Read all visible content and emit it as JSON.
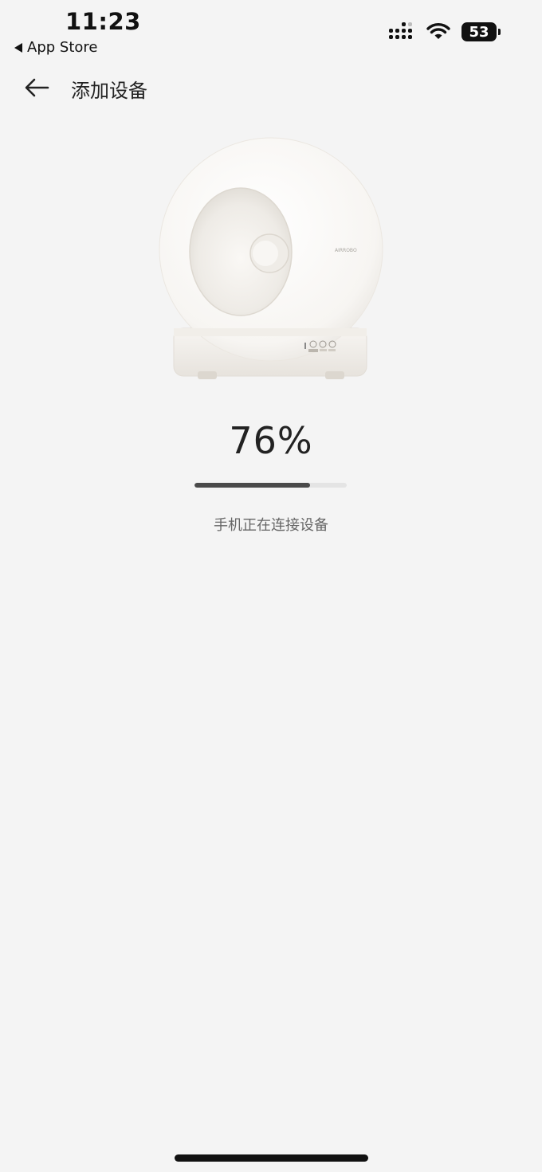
{
  "status_bar": {
    "time": "11:23",
    "back_app": "App Store",
    "battery": "53",
    "icons": [
      "signal-icon",
      "wifi-icon",
      "battery-icon"
    ]
  },
  "nav": {
    "title": "添加设备",
    "back_icon": "arrow-left-icon"
  },
  "device": {
    "brand_text": "AIRROBO",
    "image": "litter-box-device-illustration"
  },
  "progress": {
    "percent_label": "76%",
    "value": 0.76,
    "status_text": "手机正在连接设备"
  },
  "colors": {
    "background": "#f4f4f4",
    "progress_fill": "#4a4a4a",
    "progress_track": "#e4e4e4"
  }
}
